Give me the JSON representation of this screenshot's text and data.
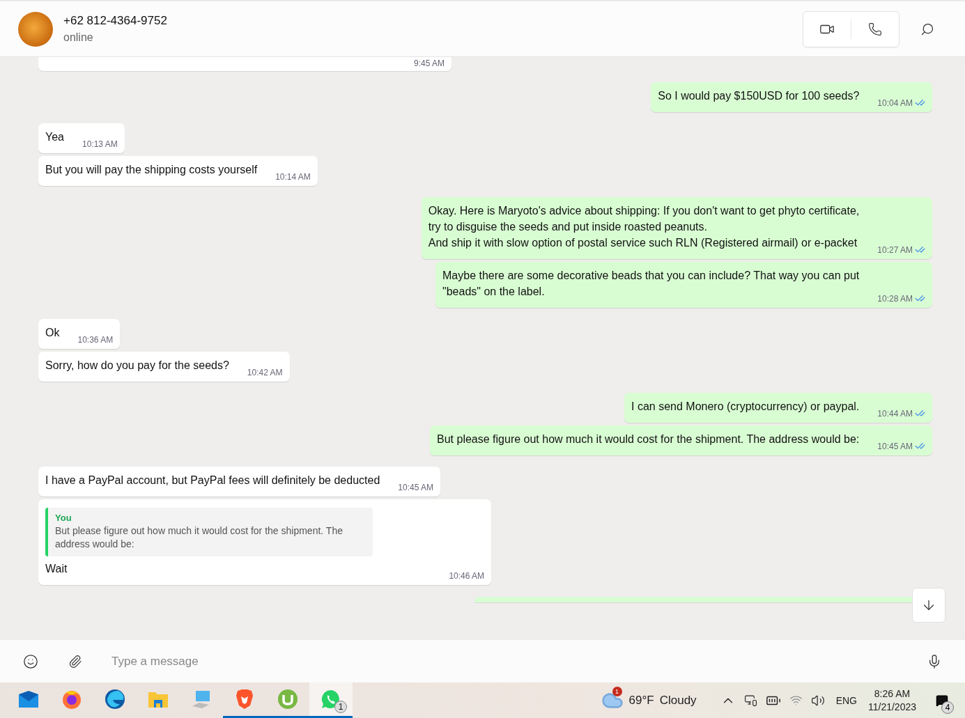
{
  "header": {
    "contact": "+62 812-4364-9752",
    "status": "online"
  },
  "messages": [
    {
      "kind": "partial_incoming",
      "time": "9:45 AM"
    },
    {
      "kind": "outgoing",
      "text": "So I would pay $150USD for 100 seeds?",
      "time": "10:04 AM",
      "read": true
    },
    {
      "kind": "incoming",
      "text": "Yea",
      "time": "10:13 AM"
    },
    {
      "kind": "incoming",
      "text": "But you will pay the shipping costs yourself",
      "time": "10:14 AM"
    },
    {
      "kind": "outgoing",
      "text": "Okay. Here is Maryoto's advice about shipping: If you don't want to get phyto certificate,\ntry to disguise the seeds and put inside roasted peanuts.\nAnd ship it with slow option of postal service such RLN (Registered airmail) or e-packet",
      "time": "10:27 AM",
      "read": true
    },
    {
      "kind": "outgoing",
      "text": "Maybe there are some decorative beads that you can include? That way you can put\n\"beads\" on the label.",
      "time": "10:28 AM",
      "read": true
    },
    {
      "kind": "incoming",
      "text": "Ok",
      "time": "10:36 AM"
    },
    {
      "kind": "incoming",
      "text": "Sorry, how do you pay for the seeds?",
      "time": "10:42 AM"
    },
    {
      "kind": "outgoing",
      "text": "I can send Monero (cryptocurrency) or paypal.",
      "time": "10:44 AM",
      "read": true
    },
    {
      "kind": "outgoing",
      "text": "But please figure out how much it would cost for the shipment. The address would be:",
      "time": "10:45 AM",
      "read": true
    },
    {
      "kind": "incoming",
      "text": "I have a PayPal account, but PayPal fees will definitely be deducted",
      "time": "10:45 AM"
    },
    {
      "kind": "incoming",
      "text": "Wait",
      "time": "10:46 AM",
      "reply": {
        "author": "You",
        "text": "But please figure out how much it would cost for the shipment. The address would be:"
      }
    },
    {
      "kind": "partial_outgoing"
    }
  ],
  "composer": {
    "placeholder": "Type a message"
  },
  "taskbar": {
    "apps": [
      {
        "kind": "mail",
        "running": false,
        "selected": false
      },
      {
        "kind": "firefox",
        "running": false,
        "selected": false
      },
      {
        "kind": "edge",
        "running": false,
        "selected": false
      },
      {
        "kind": "folder",
        "running": false,
        "selected": false
      },
      {
        "kind": "computer",
        "running": false,
        "selected": false
      },
      {
        "kind": "lion",
        "running": true,
        "selected": false
      },
      {
        "kind": "torrent",
        "running": true,
        "selected": false
      },
      {
        "kind": "chat",
        "running": true,
        "selected": true,
        "badge": "1"
      }
    ],
    "weather": {
      "badge": "1",
      "temp": "69°F",
      "condition": "Cloudy"
    },
    "language": "ENG",
    "time": "8:26 AM",
    "date": "11/21/2023",
    "notifications": "4"
  }
}
